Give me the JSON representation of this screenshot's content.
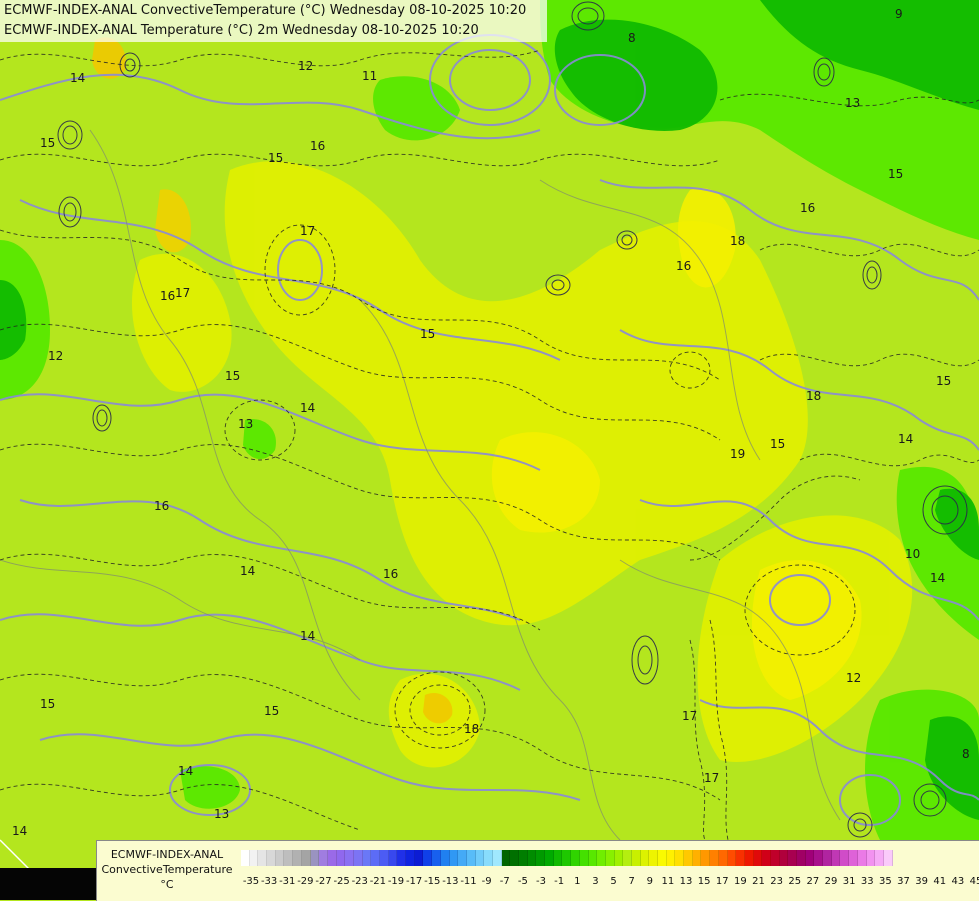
{
  "header": {
    "title_line_1": "ECMWF-INDEX-ANAL ConvectiveTemperature (°C) Wednesday 08-10-2025 10:20",
    "title_line_2": "ECMWF-INDEX-ANAL Temperature (°C) 2m Wednesday 08-10-2025 10:20"
  },
  "legend": {
    "source": "ECMWF-INDEX-ANAL",
    "parameter": "ConvectiveTemperature",
    "unit": "°C",
    "tick_labels": [
      "-35",
      "-33",
      "-31",
      "-29",
      "-27",
      "-25",
      "-23",
      "-21",
      "-19",
      "-17",
      "-15",
      "-13",
      "-11",
      "-9",
      "-7",
      "-5",
      "-3",
      "-1",
      "1",
      "3",
      "5",
      "7",
      "9",
      "11",
      "13",
      "15",
      "17",
      "19",
      "21",
      "23",
      "25",
      "27",
      "29",
      "31",
      "33",
      "35",
      "37",
      "39",
      "41",
      "43",
      "45"
    ],
    "colors": [
      "#ffffff",
      "#f2f2f2",
      "#e5e5e5",
      "#d8d8d8",
      "#cbcbcb",
      "#bebebe",
      "#b1b1b1",
      "#a4a4a4",
      "#9a93c0",
      "#a07de0",
      "#9a6ae8",
      "#9068ee",
      "#8a70f2",
      "#7c74f4",
      "#6a78f6",
      "#5c6cf6",
      "#4c5cf4",
      "#3848ee",
      "#2030e8",
      "#1024e0",
      "#0c1cd4",
      "#1040e8",
      "#1860ee",
      "#2080f0",
      "#3098f4",
      "#44aaf6",
      "#58bcf8",
      "#70ccfa",
      "#88dcfc",
      "#a0e8fe",
      "#006400",
      "#007000",
      "#007e00",
      "#008c00",
      "#009a00",
      "#00aa00",
      "#10ba00",
      "#1ec800",
      "#30d400",
      "#44e000",
      "#58e800",
      "#70ee00",
      "#88f000",
      "#a0f000",
      "#b4ee10",
      "#c8f000",
      "#dcf200",
      "#eef400",
      "#fafa00",
      "#fff000",
      "#ffe000",
      "#ffc800",
      "#ffb000",
      "#ff9800",
      "#ff8000",
      "#ff6800",
      "#ff4c00",
      "#f83000",
      "#ee1800",
      "#e00a0a",
      "#d00018",
      "#c0002a",
      "#b0003c",
      "#a80050",
      "#a00064",
      "#a00078",
      "#a8108c",
      "#b024a0",
      "#c038b4",
      "#d04cc8",
      "#de62d8",
      "#ea7ae6",
      "#f292f0",
      "#f6aaf6",
      "#facafa"
    ],
    "highlight_palette": {
      "background_green": "#b4e61e",
      "yellow_zone": "#e8f000",
      "green_zone": "#30d400",
      "contour_solid": "#8a8ad8",
      "contour_dashed": "#222222"
    }
  },
  "map": {
    "contour_labels": [
      {
        "text": "14"
      },
      {
        "text": "15"
      },
      {
        "text": "12"
      },
      {
        "text": "11"
      },
      {
        "text": "15"
      },
      {
        "text": "16"
      },
      {
        "text": "17"
      },
      {
        "text": "8"
      },
      {
        "text": "9"
      },
      {
        "text": "13"
      },
      {
        "text": "15"
      },
      {
        "text": "18"
      },
      {
        "text": "16"
      },
      {
        "text": "17"
      },
      {
        "text": "15"
      },
      {
        "text": "12"
      },
      {
        "text": "13"
      },
      {
        "text": "14"
      },
      {
        "text": "15"
      },
      {
        "text": "16"
      },
      {
        "text": "18"
      },
      {
        "text": "19"
      },
      {
        "text": "15"
      },
      {
        "text": "14"
      },
      {
        "text": "16"
      },
      {
        "text": "14"
      },
      {
        "text": "14"
      },
      {
        "text": "16"
      },
      {
        "text": "14"
      },
      {
        "text": "15"
      },
      {
        "text": "15"
      },
      {
        "text": "18"
      },
      {
        "text": "17"
      },
      {
        "text": "17"
      },
      {
        "text": "15"
      },
      {
        "text": "14"
      },
      {
        "text": "13"
      },
      {
        "text": "14"
      },
      {
        "text": "12"
      },
      {
        "text": "10"
      },
      {
        "text": "8"
      },
      {
        "text": "16"
      }
    ]
  }
}
